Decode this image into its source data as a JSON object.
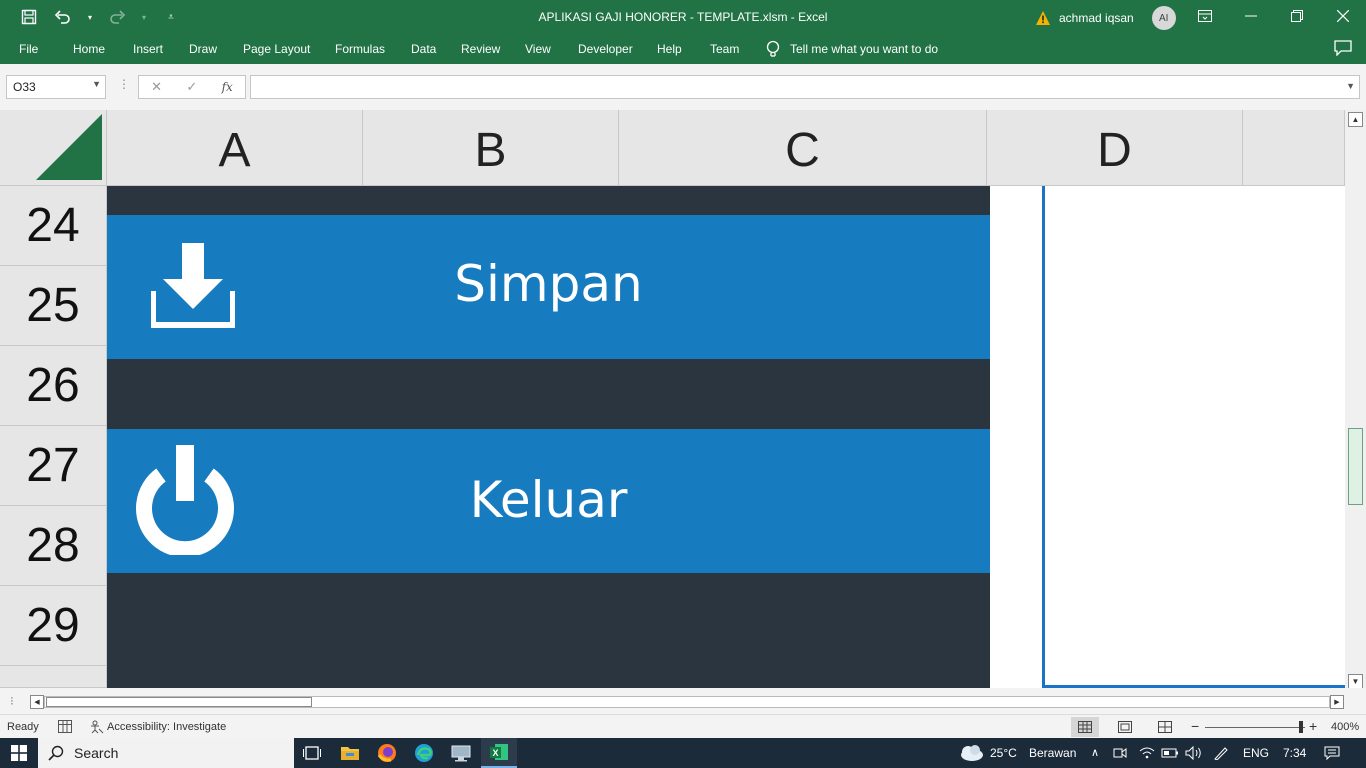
{
  "window": {
    "title": "APLIKASI GAJI HONORER - TEMPLATE.xlsm  -  Excel",
    "user_name": "achmad iqsan",
    "avatar_initials": "AI"
  },
  "ribbon": {
    "tabs": [
      "File",
      "Home",
      "Insert",
      "Draw",
      "Page Layout",
      "Formulas",
      "Data",
      "Review",
      "View",
      "Developer",
      "Help",
      "Team"
    ],
    "tell_me": "Tell me what you want to do"
  },
  "formula_bar": {
    "name_box": "O33",
    "fx_label": "fx",
    "formula": ""
  },
  "grid": {
    "columns": [
      "A",
      "B",
      "C",
      "D"
    ],
    "rows": [
      "24",
      "25",
      "26",
      "27",
      "28",
      "29"
    ]
  },
  "buttons": {
    "save_label": "Simpan",
    "exit_label": "Keluar"
  },
  "status_bar": {
    "mode": "Ready",
    "accessibility": "Accessibility: Investigate",
    "zoom": "400%"
  },
  "taskbar": {
    "search_label": "Search",
    "weather_temp": "25°C",
    "weather_desc": "Berawan",
    "language": "ENG",
    "time": "7:34"
  },
  "colors": {
    "excel_green": "#217346",
    "button_blue": "#167bbf",
    "sheet_dark": "#2a3540",
    "selection_blue": "#1a73c8"
  }
}
